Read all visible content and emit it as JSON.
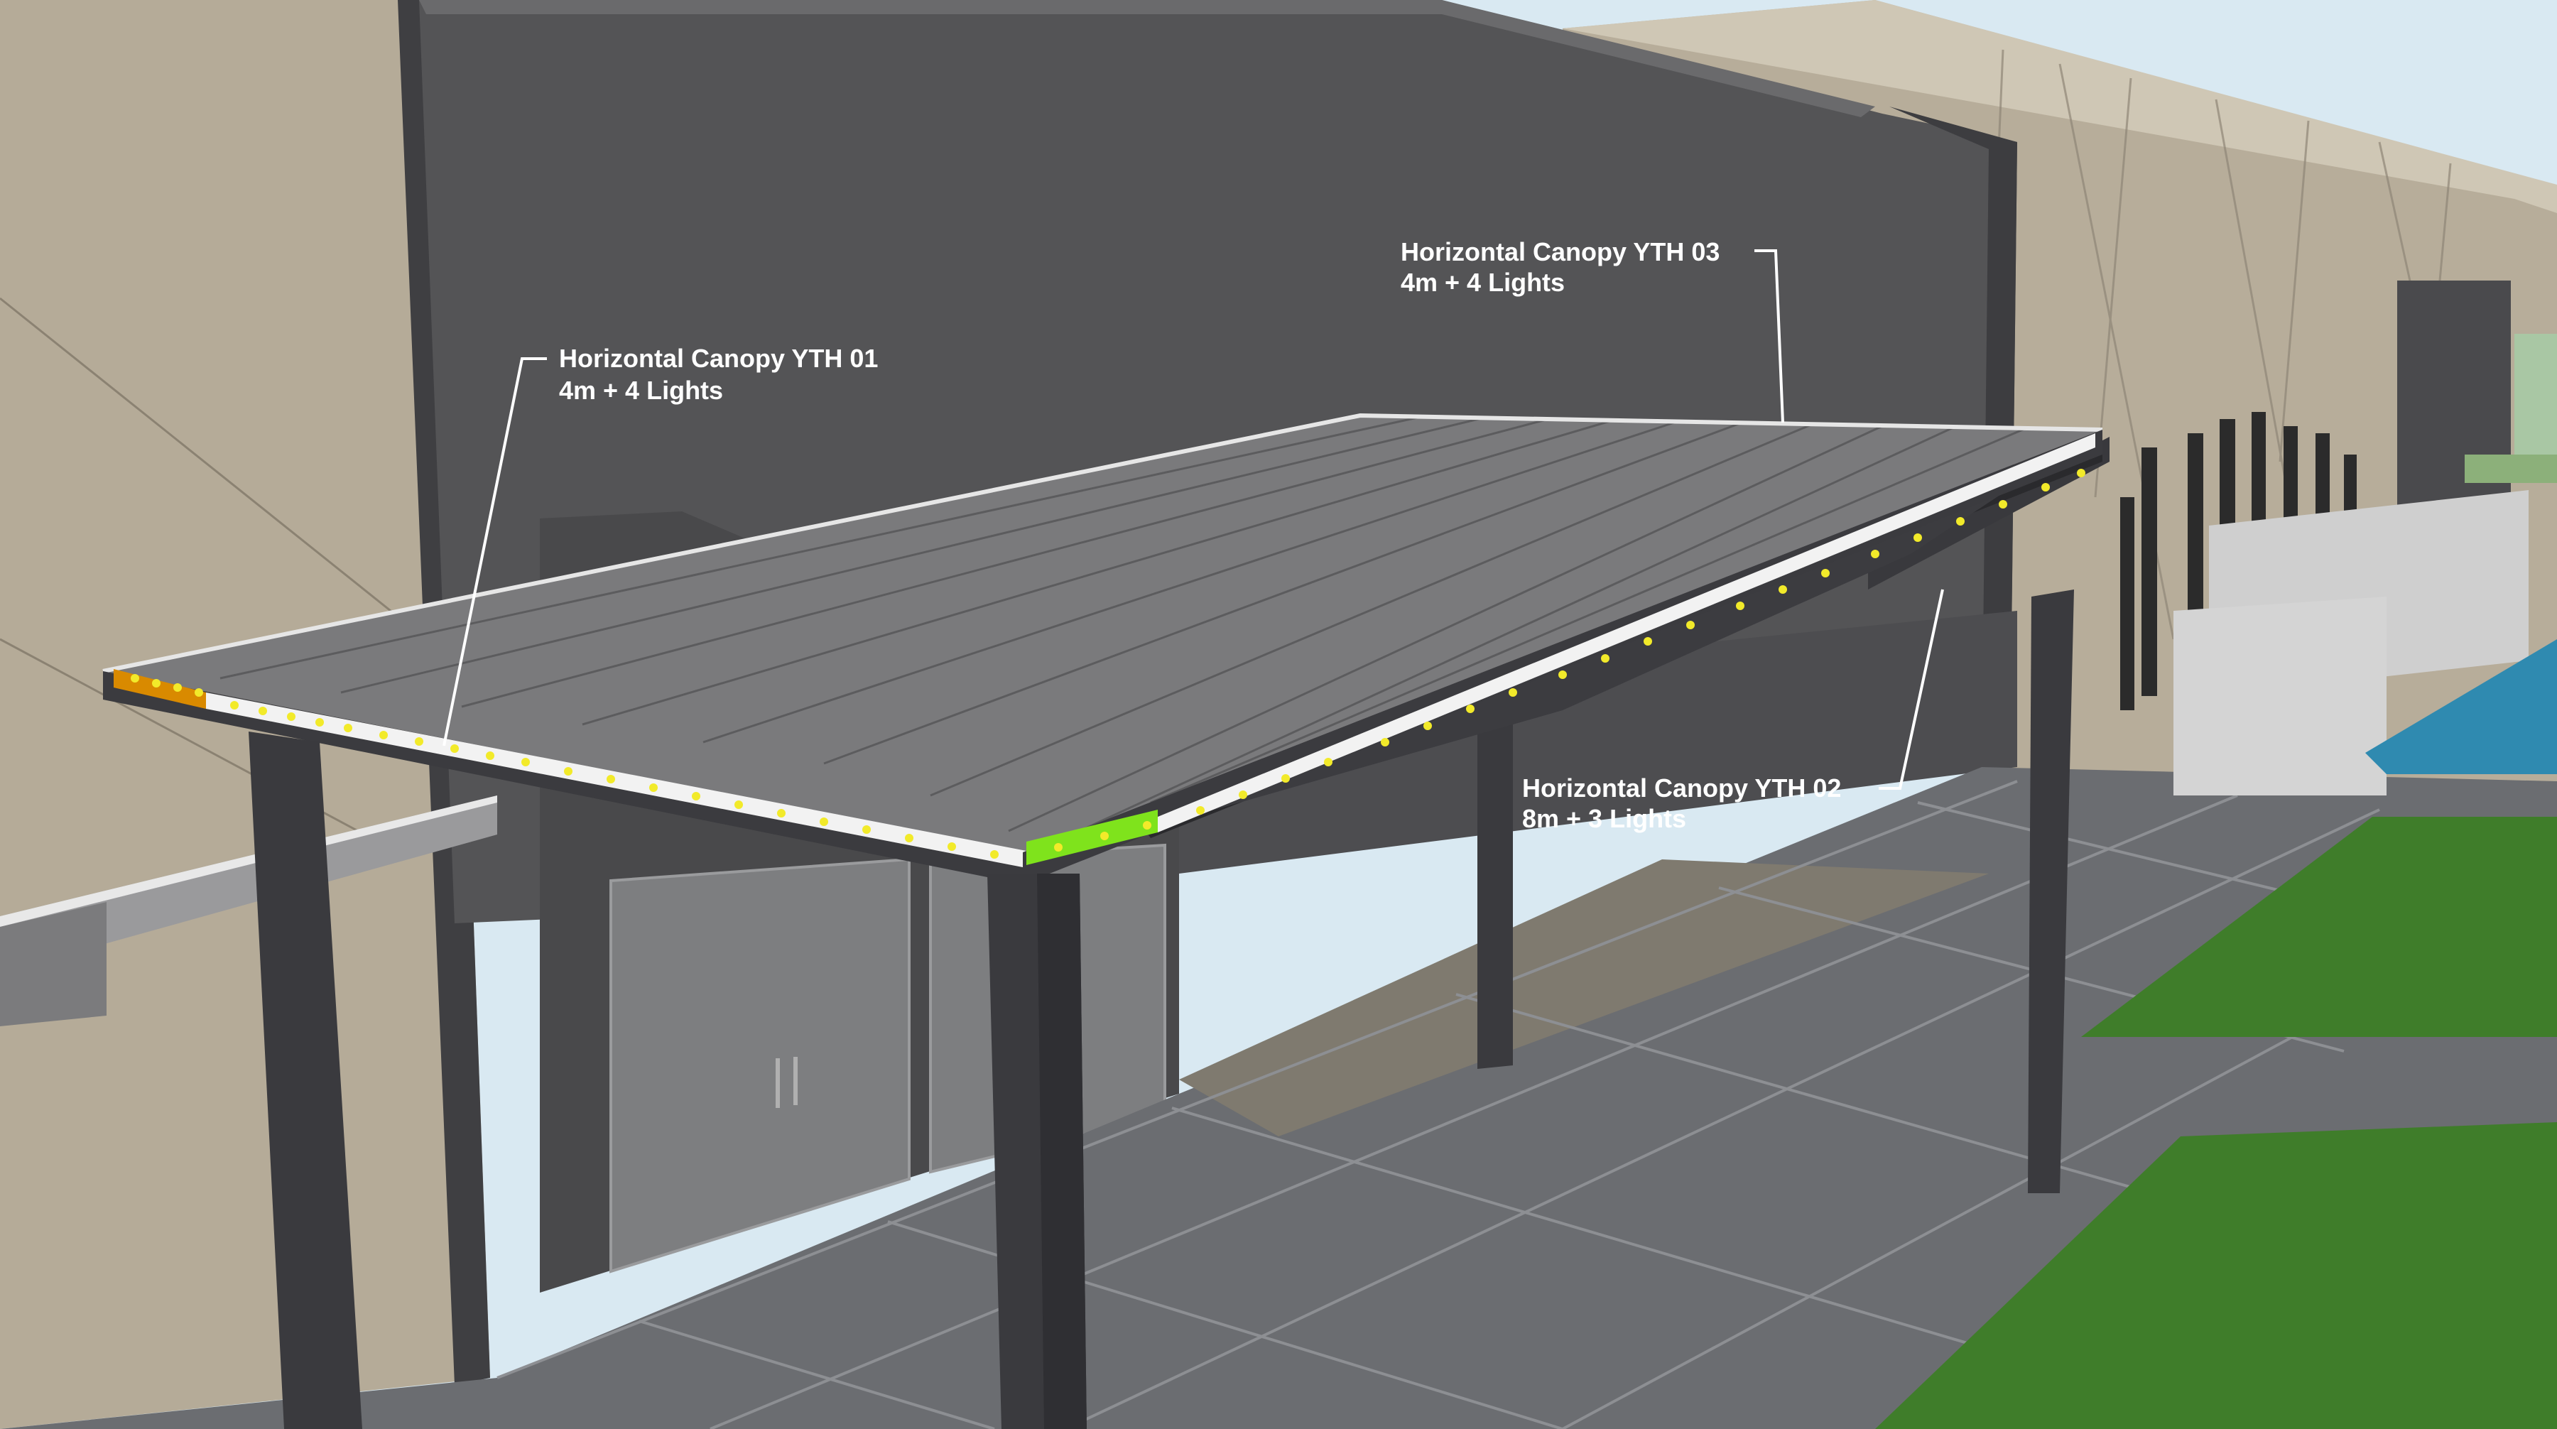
{
  "annotations": [
    {
      "title": "Horizontal Canopy YTH 01",
      "detail": "4m + 4 Lights"
    },
    {
      "title": "Horizontal Canopy YTH 03",
      "detail": "4m + 4 Lights"
    },
    {
      "title": "Horizontal Canopy YTH 02",
      "detail": "8m + 3 Lights"
    }
  ],
  "colors": {
    "sky": "#d9e9f2",
    "wall_beige": "#b5ab98",
    "wall_dark": "#555555",
    "roof": "#7a7a7a",
    "frame": "#3e3e42",
    "floor": "#6d6f73",
    "grass": "#3f7d2a",
    "water": "#2f8ab0",
    "light_yellow": "#f2ea2a",
    "highlight_green": "#7fe31c",
    "highlight_orange": "#d98a00"
  }
}
